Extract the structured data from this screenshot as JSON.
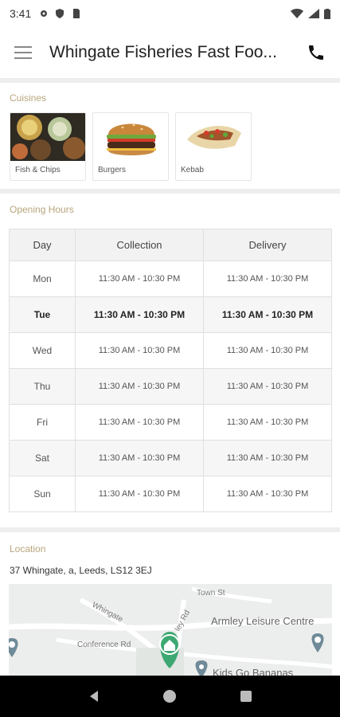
{
  "status_bar": {
    "time": "3:41"
  },
  "header": {
    "title": "Whingate Fisheries Fast Foo..."
  },
  "cuisines": {
    "label": "Cuisines",
    "items": [
      {
        "name": "Fish & Chips",
        "icon": "fish-chips-image"
      },
      {
        "name": "Burgers",
        "icon": "burger-image"
      },
      {
        "name": "Kebab",
        "icon": "kebab-image"
      }
    ]
  },
  "opening_hours": {
    "label": "Opening Hours",
    "columns": [
      "Day",
      "Collection",
      "Delivery"
    ],
    "rows": [
      {
        "day": "Mon",
        "collection": "11:30 AM - 10:30 PM",
        "delivery": "11:30 AM - 10:30 PM"
      },
      {
        "day": "Tue",
        "collection": "11:30 AM - 10:30 PM",
        "delivery": "11:30 AM - 10:30 PM"
      },
      {
        "day": "Wed",
        "collection": "11:30 AM - 10:30 PM",
        "delivery": "11:30 AM - 10:30 PM"
      },
      {
        "day": "Thu",
        "collection": "11:30 AM - 10:30 PM",
        "delivery": "11:30 AM - 10:30 PM"
      },
      {
        "day": "Fri",
        "collection": "11:30 AM - 10:30 PM",
        "delivery": "11:30 AM - 10:30 PM"
      },
      {
        "day": "Sat",
        "collection": "11:30 AM - 10:30 PM",
        "delivery": "11:30 AM - 10:30 PM"
      },
      {
        "day": "Sun",
        "collection": "11:30 AM - 10:30 PM",
        "delivery": "11:30 AM - 10:30 PM"
      }
    ]
  },
  "location": {
    "label": "Location",
    "address": "37 Whingate, a, Leeds, LS12 3EJ",
    "map_labels": {
      "street1": "Whingate",
      "street2": "Town St",
      "street3": "Conference Rd",
      "street4": "ley Rd",
      "poi1": "Armley Leisure Centre",
      "poi2": "Kids Go Bananas"
    }
  },
  "colors": {
    "section_label": "#b8a57c",
    "pin": "#3ea872"
  }
}
